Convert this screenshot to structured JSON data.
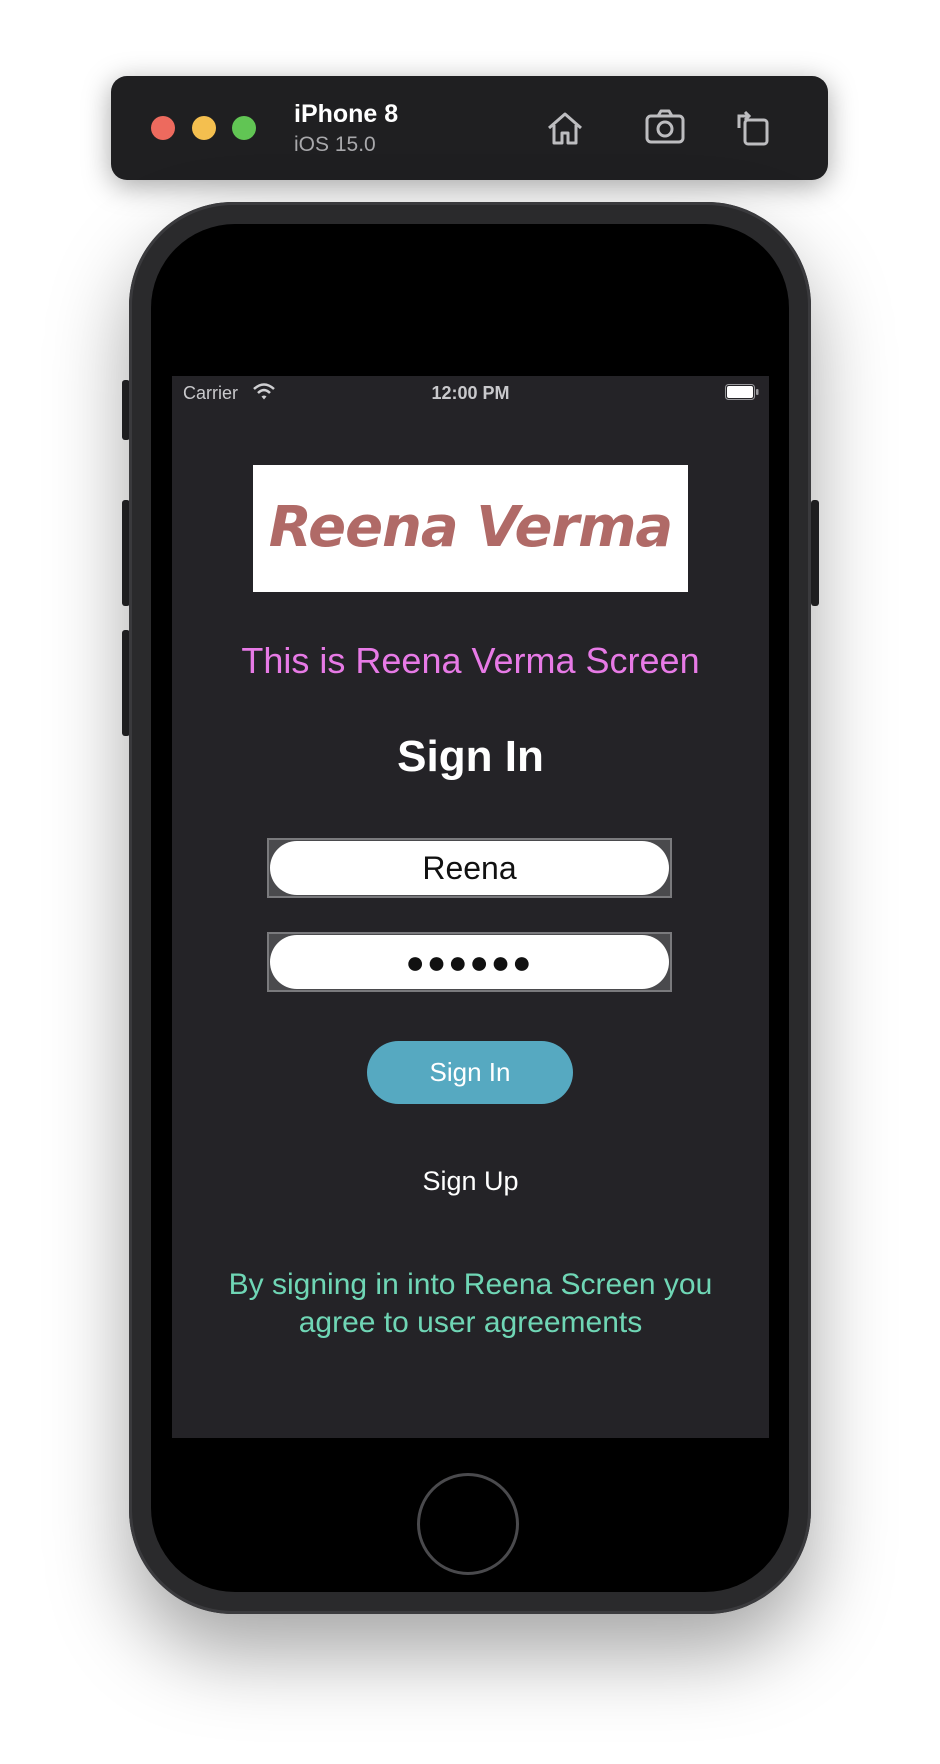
{
  "simulator": {
    "device_name": "iPhone 8",
    "os_version": "iOS 15.0",
    "icons": [
      "home-icon",
      "screenshot-icon",
      "rotate-icon"
    ]
  },
  "status_bar": {
    "carrier": "Carrier",
    "time": "12:00 PM",
    "icons": [
      "wifi-icon",
      "battery-icon"
    ]
  },
  "app": {
    "logo_text": "Reena Verma",
    "subtitle": "This is Reena Verma Screen",
    "heading": "Sign In",
    "username_value": "Reena",
    "password_value": "●●●●●●",
    "signin_label": "Sign In",
    "signup_label": "Sign Up",
    "agreement_text": "By signing in into Reena Screen you agree to user agreements"
  },
  "colors": {
    "screen_background": "#242327",
    "subtitle": "#e77ae6",
    "logo_text": "#b06a67",
    "signin_button": "#56a9c1",
    "agreement": "#6fd6b5"
  }
}
